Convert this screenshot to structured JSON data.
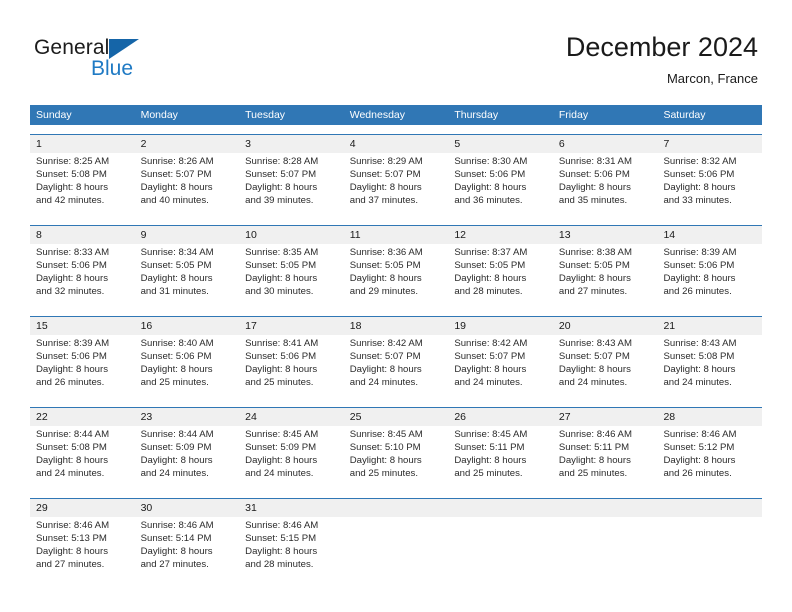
{
  "brand": {
    "name_part1": "General",
    "name_part2": "Blue",
    "accent_color": "#1f7ac4",
    "triangle_color": "#1565a8"
  },
  "header": {
    "title": "December 2024",
    "subtitle": "Marcon, France"
  },
  "calendar": {
    "header_bg": "#3077b5",
    "daynumber_bg": "#f0f0f0",
    "day_names": [
      "Sunday",
      "Monday",
      "Tuesday",
      "Wednesday",
      "Thursday",
      "Friday",
      "Saturday"
    ],
    "weeks": [
      [
        {
          "day": "1",
          "sunrise": "Sunrise: 8:25 AM",
          "sunset": "Sunset: 5:08 PM",
          "daylight1": "Daylight: 8 hours",
          "daylight2": "and 42 minutes."
        },
        {
          "day": "2",
          "sunrise": "Sunrise: 8:26 AM",
          "sunset": "Sunset: 5:07 PM",
          "daylight1": "Daylight: 8 hours",
          "daylight2": "and 40 minutes."
        },
        {
          "day": "3",
          "sunrise": "Sunrise: 8:28 AM",
          "sunset": "Sunset: 5:07 PM",
          "daylight1": "Daylight: 8 hours",
          "daylight2": "and 39 minutes."
        },
        {
          "day": "4",
          "sunrise": "Sunrise: 8:29 AM",
          "sunset": "Sunset: 5:07 PM",
          "daylight1": "Daylight: 8 hours",
          "daylight2": "and 37 minutes."
        },
        {
          "day": "5",
          "sunrise": "Sunrise: 8:30 AM",
          "sunset": "Sunset: 5:06 PM",
          "daylight1": "Daylight: 8 hours",
          "daylight2": "and 36 minutes."
        },
        {
          "day": "6",
          "sunrise": "Sunrise: 8:31 AM",
          "sunset": "Sunset: 5:06 PM",
          "daylight1": "Daylight: 8 hours",
          "daylight2": "and 35 minutes."
        },
        {
          "day": "7",
          "sunrise": "Sunrise: 8:32 AM",
          "sunset": "Sunset: 5:06 PM",
          "daylight1": "Daylight: 8 hours",
          "daylight2": "and 33 minutes."
        }
      ],
      [
        {
          "day": "8",
          "sunrise": "Sunrise: 8:33 AM",
          "sunset": "Sunset: 5:06 PM",
          "daylight1": "Daylight: 8 hours",
          "daylight2": "and 32 minutes."
        },
        {
          "day": "9",
          "sunrise": "Sunrise: 8:34 AM",
          "sunset": "Sunset: 5:05 PM",
          "daylight1": "Daylight: 8 hours",
          "daylight2": "and 31 minutes."
        },
        {
          "day": "10",
          "sunrise": "Sunrise: 8:35 AM",
          "sunset": "Sunset: 5:05 PM",
          "daylight1": "Daylight: 8 hours",
          "daylight2": "and 30 minutes."
        },
        {
          "day": "11",
          "sunrise": "Sunrise: 8:36 AM",
          "sunset": "Sunset: 5:05 PM",
          "daylight1": "Daylight: 8 hours",
          "daylight2": "and 29 minutes."
        },
        {
          "day": "12",
          "sunrise": "Sunrise: 8:37 AM",
          "sunset": "Sunset: 5:05 PM",
          "daylight1": "Daylight: 8 hours",
          "daylight2": "and 28 minutes."
        },
        {
          "day": "13",
          "sunrise": "Sunrise: 8:38 AM",
          "sunset": "Sunset: 5:05 PM",
          "daylight1": "Daylight: 8 hours",
          "daylight2": "and 27 minutes."
        },
        {
          "day": "14",
          "sunrise": "Sunrise: 8:39 AM",
          "sunset": "Sunset: 5:06 PM",
          "daylight1": "Daylight: 8 hours",
          "daylight2": "and 26 minutes."
        }
      ],
      [
        {
          "day": "15",
          "sunrise": "Sunrise: 8:39 AM",
          "sunset": "Sunset: 5:06 PM",
          "daylight1": "Daylight: 8 hours",
          "daylight2": "and 26 minutes."
        },
        {
          "day": "16",
          "sunrise": "Sunrise: 8:40 AM",
          "sunset": "Sunset: 5:06 PM",
          "daylight1": "Daylight: 8 hours",
          "daylight2": "and 25 minutes."
        },
        {
          "day": "17",
          "sunrise": "Sunrise: 8:41 AM",
          "sunset": "Sunset: 5:06 PM",
          "daylight1": "Daylight: 8 hours",
          "daylight2": "and 25 minutes."
        },
        {
          "day": "18",
          "sunrise": "Sunrise: 8:42 AM",
          "sunset": "Sunset: 5:07 PM",
          "daylight1": "Daylight: 8 hours",
          "daylight2": "and 24 minutes."
        },
        {
          "day": "19",
          "sunrise": "Sunrise: 8:42 AM",
          "sunset": "Sunset: 5:07 PM",
          "daylight1": "Daylight: 8 hours",
          "daylight2": "and 24 minutes."
        },
        {
          "day": "20",
          "sunrise": "Sunrise: 8:43 AM",
          "sunset": "Sunset: 5:07 PM",
          "daylight1": "Daylight: 8 hours",
          "daylight2": "and 24 minutes."
        },
        {
          "day": "21",
          "sunrise": "Sunrise: 8:43 AM",
          "sunset": "Sunset: 5:08 PM",
          "daylight1": "Daylight: 8 hours",
          "daylight2": "and 24 minutes."
        }
      ],
      [
        {
          "day": "22",
          "sunrise": "Sunrise: 8:44 AM",
          "sunset": "Sunset: 5:08 PM",
          "daylight1": "Daylight: 8 hours",
          "daylight2": "and 24 minutes."
        },
        {
          "day": "23",
          "sunrise": "Sunrise: 8:44 AM",
          "sunset": "Sunset: 5:09 PM",
          "daylight1": "Daylight: 8 hours",
          "daylight2": "and 24 minutes."
        },
        {
          "day": "24",
          "sunrise": "Sunrise: 8:45 AM",
          "sunset": "Sunset: 5:09 PM",
          "daylight1": "Daylight: 8 hours",
          "daylight2": "and 24 minutes."
        },
        {
          "day": "25",
          "sunrise": "Sunrise: 8:45 AM",
          "sunset": "Sunset: 5:10 PM",
          "daylight1": "Daylight: 8 hours",
          "daylight2": "and 25 minutes."
        },
        {
          "day": "26",
          "sunrise": "Sunrise: 8:45 AM",
          "sunset": "Sunset: 5:11 PM",
          "daylight1": "Daylight: 8 hours",
          "daylight2": "and 25 minutes."
        },
        {
          "day": "27",
          "sunrise": "Sunrise: 8:46 AM",
          "sunset": "Sunset: 5:11 PM",
          "daylight1": "Daylight: 8 hours",
          "daylight2": "and 25 minutes."
        },
        {
          "day": "28",
          "sunrise": "Sunrise: 8:46 AM",
          "sunset": "Sunset: 5:12 PM",
          "daylight1": "Daylight: 8 hours",
          "daylight2": "and 26 minutes."
        }
      ],
      [
        {
          "day": "29",
          "sunrise": "Sunrise: 8:46 AM",
          "sunset": "Sunset: 5:13 PM",
          "daylight1": "Daylight: 8 hours",
          "daylight2": "and 27 minutes."
        },
        {
          "day": "30",
          "sunrise": "Sunrise: 8:46 AM",
          "sunset": "Sunset: 5:14 PM",
          "daylight1": "Daylight: 8 hours",
          "daylight2": "and 27 minutes."
        },
        {
          "day": "31",
          "sunrise": "Sunrise: 8:46 AM",
          "sunset": "Sunset: 5:15 PM",
          "daylight1": "Daylight: 8 hours",
          "daylight2": "and 28 minutes."
        },
        {
          "day": "",
          "sunrise": "",
          "sunset": "",
          "daylight1": "",
          "daylight2": ""
        },
        {
          "day": "",
          "sunrise": "",
          "sunset": "",
          "daylight1": "",
          "daylight2": ""
        },
        {
          "day": "",
          "sunrise": "",
          "sunset": "",
          "daylight1": "",
          "daylight2": ""
        },
        {
          "day": "",
          "sunrise": "",
          "sunset": "",
          "daylight1": "",
          "daylight2": ""
        }
      ]
    ]
  }
}
